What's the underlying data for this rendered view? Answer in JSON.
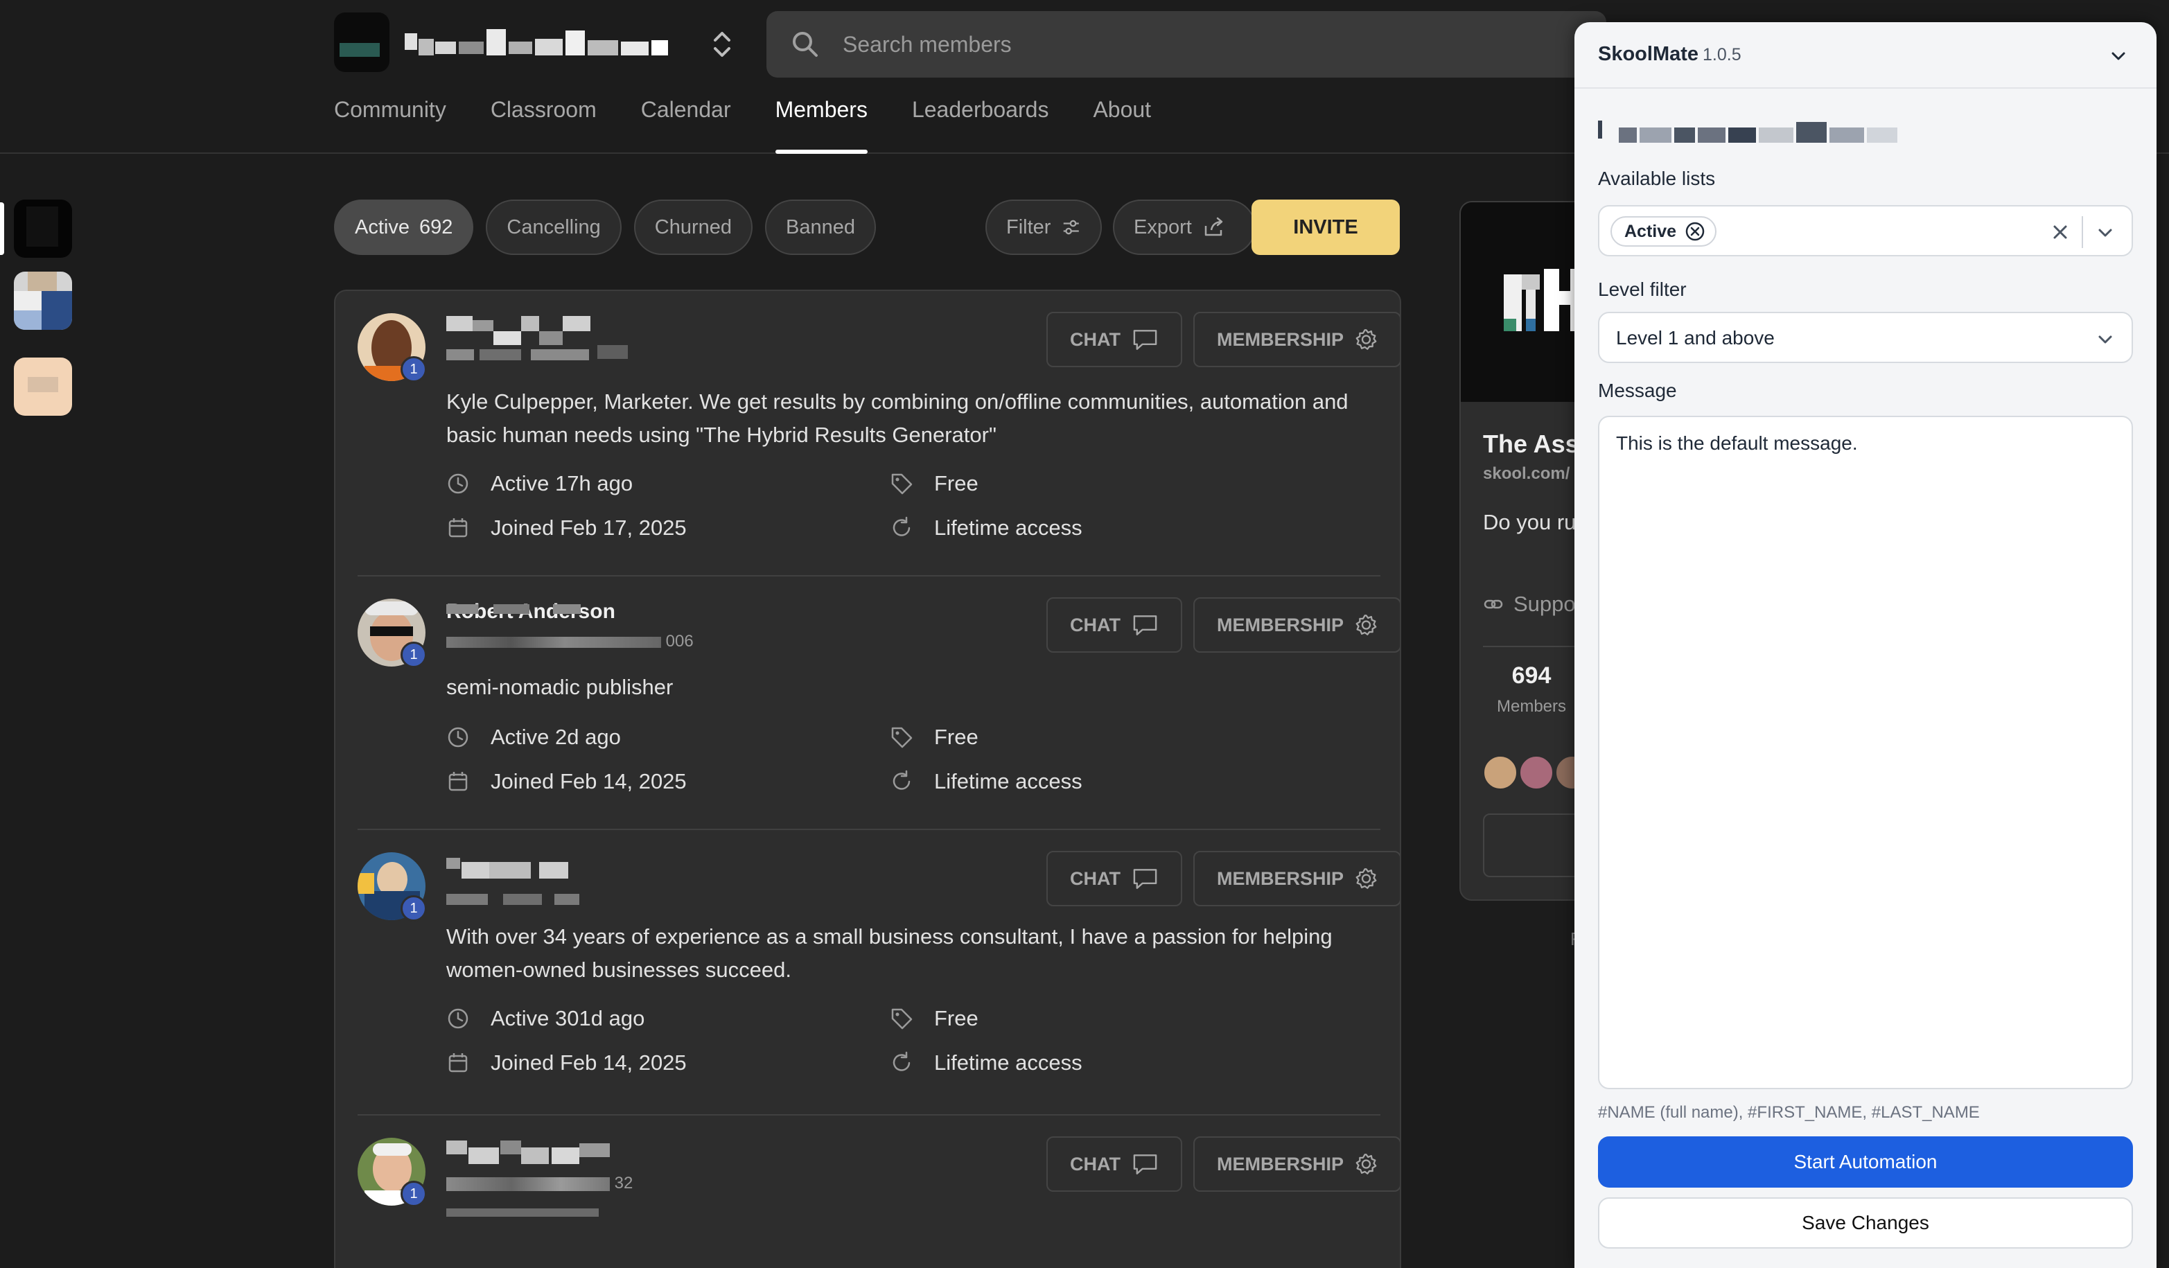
{
  "header": {
    "search_placeholder": "Search members"
  },
  "nav": {
    "tabs": [
      {
        "label": "Community"
      },
      {
        "label": "Classroom"
      },
      {
        "label": "Calendar"
      },
      {
        "label": "Members",
        "active": true
      },
      {
        "label": "Leaderboards"
      },
      {
        "label": "About"
      }
    ]
  },
  "filters": {
    "chips": [
      {
        "label": "Active",
        "count": "692",
        "active": true
      },
      {
        "label": "Cancelling"
      },
      {
        "label": "Churned"
      },
      {
        "label": "Banned"
      }
    ],
    "filter_label": "Filter",
    "export_label": "Export",
    "invite_label": "INVITE"
  },
  "members": [
    {
      "name": "",
      "level": "1",
      "bio": "Kyle Culpepper, Marketer. We get results by combining on/offline communities, automation and basic human needs using \"The Hybrid Results Generator\"",
      "active": "Active 17h ago",
      "joined": "Joined Feb 17, 2025",
      "price": "Free",
      "access": "Lifetime access",
      "chat_label": "CHAT",
      "membership_label": "MEMBERSHIP"
    },
    {
      "name": "Robert Anderson",
      "handle_suffix": "006",
      "level": "1",
      "bio": "semi-nomadic publisher",
      "active": "Active 2d ago",
      "joined": "Joined Feb 14, 2025",
      "price": "Free",
      "access": "Lifetime access",
      "chat_label": "CHAT",
      "membership_label": "MEMBERSHIP"
    },
    {
      "name": "",
      "level": "1",
      "bio": "With over 34 years of experience as a small business consultant, I have a passion for helping women-owned businesses succeed.",
      "active": "Active 301d ago",
      "joined": "Joined Feb 14, 2025",
      "price": "Free",
      "access": "Lifetime access",
      "chat_label": "CHAT",
      "membership_label": "MEMBERSHIP"
    },
    {
      "name": "",
      "handle_suffix": "32",
      "level": "1",
      "chat_label": "CHAT",
      "membership_label": "MEMBERSHIP"
    }
  ],
  "group_card": {
    "title": "The Ass",
    "url": "skool.com/",
    "description": "Do you ru agency? T",
    "link_label": "Suppo",
    "members_count": "694",
    "members_label": "Members",
    "footer_fragment": "F"
  },
  "skoolmate": {
    "title": "SkoolMate",
    "version": "1.0.5",
    "available_lists_label": "Available lists",
    "selected_list": "Active",
    "level_filter_label": "Level filter",
    "level_filter_value": "Level 1 and above",
    "message_label": "Message",
    "message_value": "This is the default message.",
    "hint": "#NAME (full name), #FIRST_NAME, #LAST_NAME",
    "start_label": "Start Automation",
    "save_label": "Save Changes",
    "colors": {
      "primary": "#1d5fe0"
    }
  },
  "colors": {
    "background": "#1c1c1c",
    "card": "#2d2d2d",
    "invite": "#f2d37a",
    "level_badge": "#3b5bb5"
  },
  "icons": [
    "search-icon",
    "switch-icon",
    "sliders-icon",
    "export-icon",
    "chat-icon",
    "gear-icon",
    "clock-icon",
    "calendar-icon",
    "tag-icon",
    "refresh-icon",
    "link-icon",
    "chevron-down-icon",
    "close-icon"
  ]
}
